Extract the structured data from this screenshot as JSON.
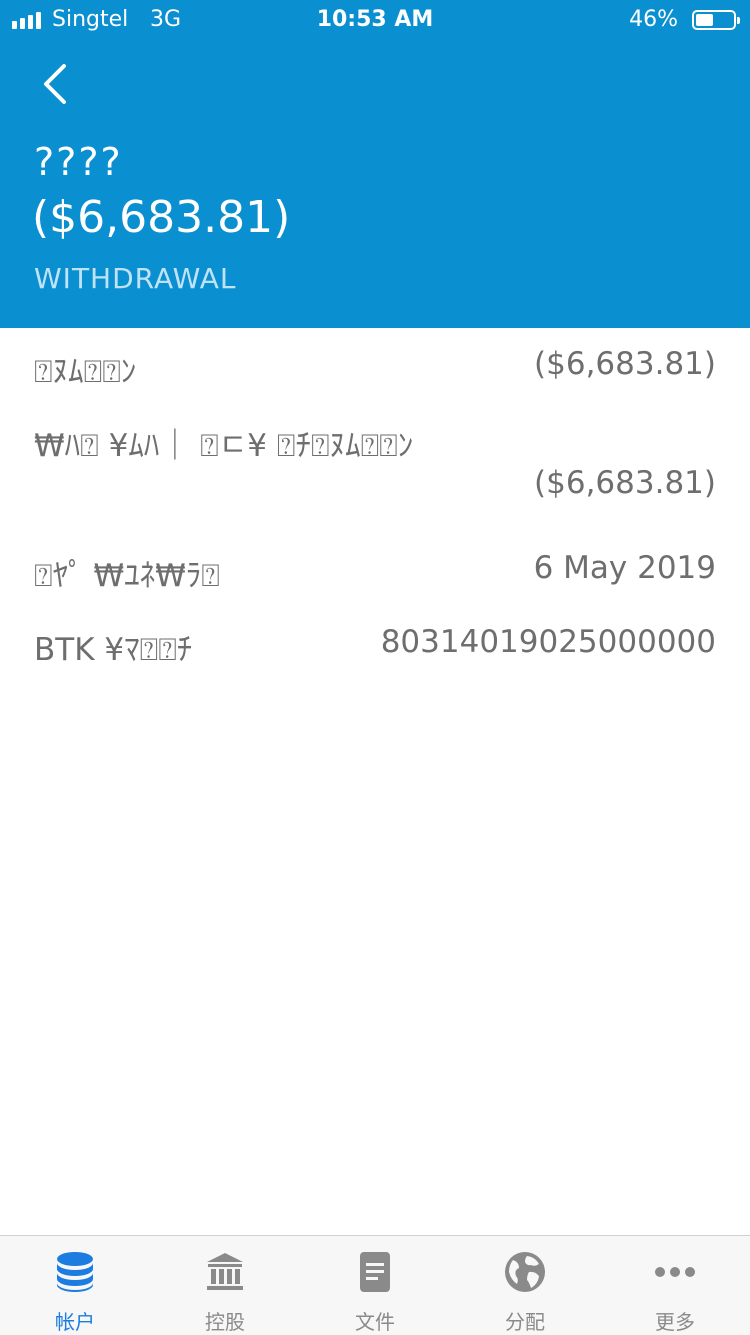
{
  "status_bar": {
    "carrier": "Singtel",
    "network": "3G",
    "time": "10:53 AM",
    "battery_percent": "46%",
    "battery_level": 0.46
  },
  "header": {
    "title": "????",
    "amount": "($6,683.81)",
    "type": "WITHDRAWAL"
  },
  "details": {
    "rows": [
      {
        "label": "⍰ﾇﾑ⍰⍰ﾝ",
        "value": "($6,683.81)"
      },
      {
        "label": "₩ﾊ⍰ ¥ﾑﾊ｜ ⍰ㄷ¥ ⍰ﾁ⍰ﾇﾑ⍰⍰ﾝ",
        "value": "($6,683.81)"
      },
      {
        "label": "⍰ﾔﾟ ₩ﾕﾈ₩ﾗ⍰",
        "value": "6 May 2019"
      },
      {
        "label": "BTK ¥ﾏ⍰⍰ﾁ",
        "value": "80314019025000000"
      }
    ]
  },
  "tabbar": {
    "active_color": "#1c7ce0",
    "inactive_color": "#8a8a8a",
    "tabs": [
      {
        "label": "帐户",
        "icon": "database-icon",
        "active": true
      },
      {
        "label": "控股",
        "icon": "bank-icon",
        "active": false
      },
      {
        "label": "文件",
        "icon": "document-icon",
        "active": false
      },
      {
        "label": "分配",
        "icon": "globe-icon",
        "active": false
      },
      {
        "label": "更多",
        "icon": "more-icon",
        "active": false
      }
    ]
  },
  "colors": {
    "header_bg": "#0a8fd0",
    "text_gray": "#6e6e6e"
  }
}
